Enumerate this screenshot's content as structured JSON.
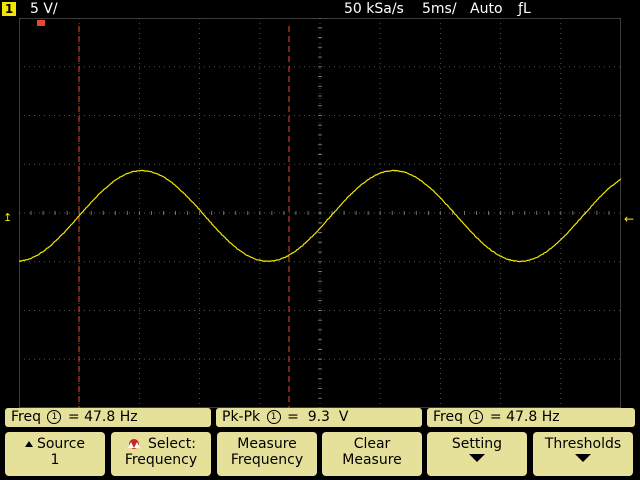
{
  "top_bar": {
    "channel_number": "1",
    "vertical_scale": "5 V/",
    "sample_rate": "50 kSa/s",
    "timebase": "5ms/",
    "trigger_mode": "Auto",
    "trigger_slope_symbol": "ƒ",
    "trigger_source": "L"
  },
  "display": {
    "trace_color": "#f2e600",
    "cursor_color": "#e14a2e",
    "trigger_marker_color": "#f2e600",
    "signal_frequency_hz": 47.8,
    "peak_to_peak_volts": 9.3,
    "grid": true
  },
  "measurements": [
    {
      "name": "Freq",
      "channel": "1",
      "value": "= 47.8 Hz"
    },
    {
      "name": "Pk-Pk",
      "channel": "1",
      "value": "=  9.3  V"
    },
    {
      "name": "Freq",
      "channel": "1",
      "value": "= 47.8 Hz"
    }
  ],
  "softkeys": {
    "source": {
      "line1": "Source",
      "line2": "1"
    },
    "select": {
      "line1": "Select:",
      "line2": "Frequency"
    },
    "measure": {
      "line1": "Measure",
      "line2": "Frequency"
    },
    "clear": {
      "line1": "Clear",
      "line2": "Measure"
    },
    "setting": {
      "line1": "Setting"
    },
    "thresholds": {
      "line1": "Thresholds"
    }
  },
  "icons": {
    "source_softkey": "up-triangle-icon",
    "select_softkey": "entry-knob-icon",
    "setting_softkey": "down-arrow-icon",
    "thresholds_softkey": "down-arrow-icon"
  }
}
